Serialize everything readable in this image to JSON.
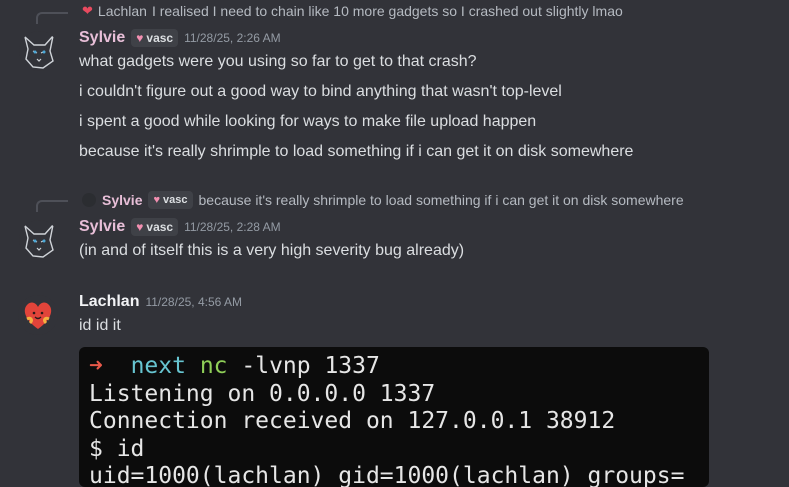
{
  "reply1": {
    "author": "Lachlan",
    "text": "I realised I need to chain like 10 more gadgets so I crashed out slightly lmao"
  },
  "msg1": {
    "author": "Sylvie",
    "tag": "vasc",
    "time": "11/28/25, 2:26 AM",
    "lines": [
      "what gadgets were you using so far to get to that crash?",
      "i couldn't figure out a good way to bind anything that wasn't top-level",
      "i spent a good while looking for ways to make file upload happen",
      "because it's really shrimple to load something if i can get it on disk somewhere"
    ]
  },
  "reply2": {
    "author": "Sylvie",
    "tag": "vasc",
    "text": "because it's really shrimple to load something if i can get it on disk somewhere"
  },
  "msg2": {
    "author": "Sylvie",
    "tag": "vasc",
    "time": "11/28/25, 2:28 AM",
    "lines": [
      "(in and of itself this is a very high severity bug already)"
    ]
  },
  "msg3": {
    "author": "Lachlan",
    "time": "11/28/25, 4:56 AM",
    "lines": [
      "id id it"
    ]
  },
  "terminal": {
    "prompt_arrow": "➜",
    "prompt_dir": "next",
    "prompt_cmd": "nc",
    "prompt_args": "-lvnp 1337",
    "line2": "Listening on 0.0.0.0 1337",
    "line3": "Connection received on 127.0.0.1 38912",
    "line4": "$ id",
    "line5": "uid=1000(lachlan) gid=1000(lachlan) groups="
  },
  "colors": {
    "background": "#323339",
    "sylvie_name": "#e8bfd8",
    "lachlan_name": "#f2f3f5",
    "timestamp": "#949ba4",
    "terminal_bg": "#0c0c0c"
  }
}
